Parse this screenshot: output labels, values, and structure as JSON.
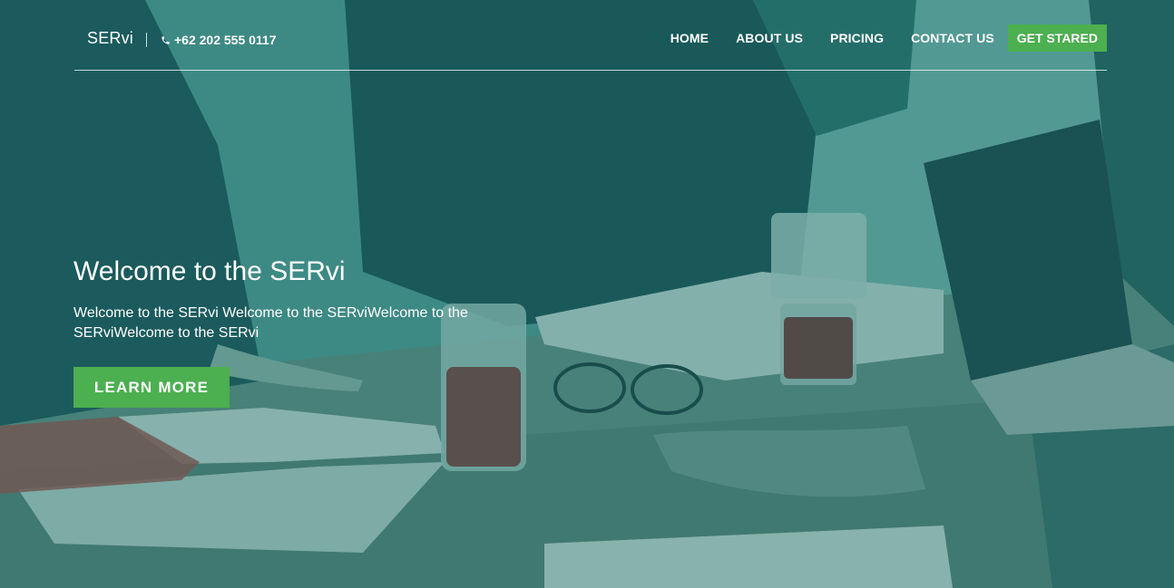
{
  "header": {
    "logo": "SERvi",
    "phone": "+62 202 555 0117",
    "phone_icon": "phone-icon"
  },
  "nav": {
    "items": [
      {
        "label": "HOME"
      },
      {
        "label": "ABOUT US"
      },
      {
        "label": "PRICING"
      },
      {
        "label": "CONTACT US"
      }
    ],
    "cta_label": "GET STARED"
  },
  "hero": {
    "title": "Welcome to the SERvi",
    "text": "Welcome to the SERvi Welcome to the SERviWelcome to the SERviWelcome to the SERvi",
    "button_label": "LEARN MORE",
    "background_image": "team-meeting-photo"
  },
  "colors": {
    "accent": "#4caf50",
    "overlay": "#1a6e68"
  }
}
